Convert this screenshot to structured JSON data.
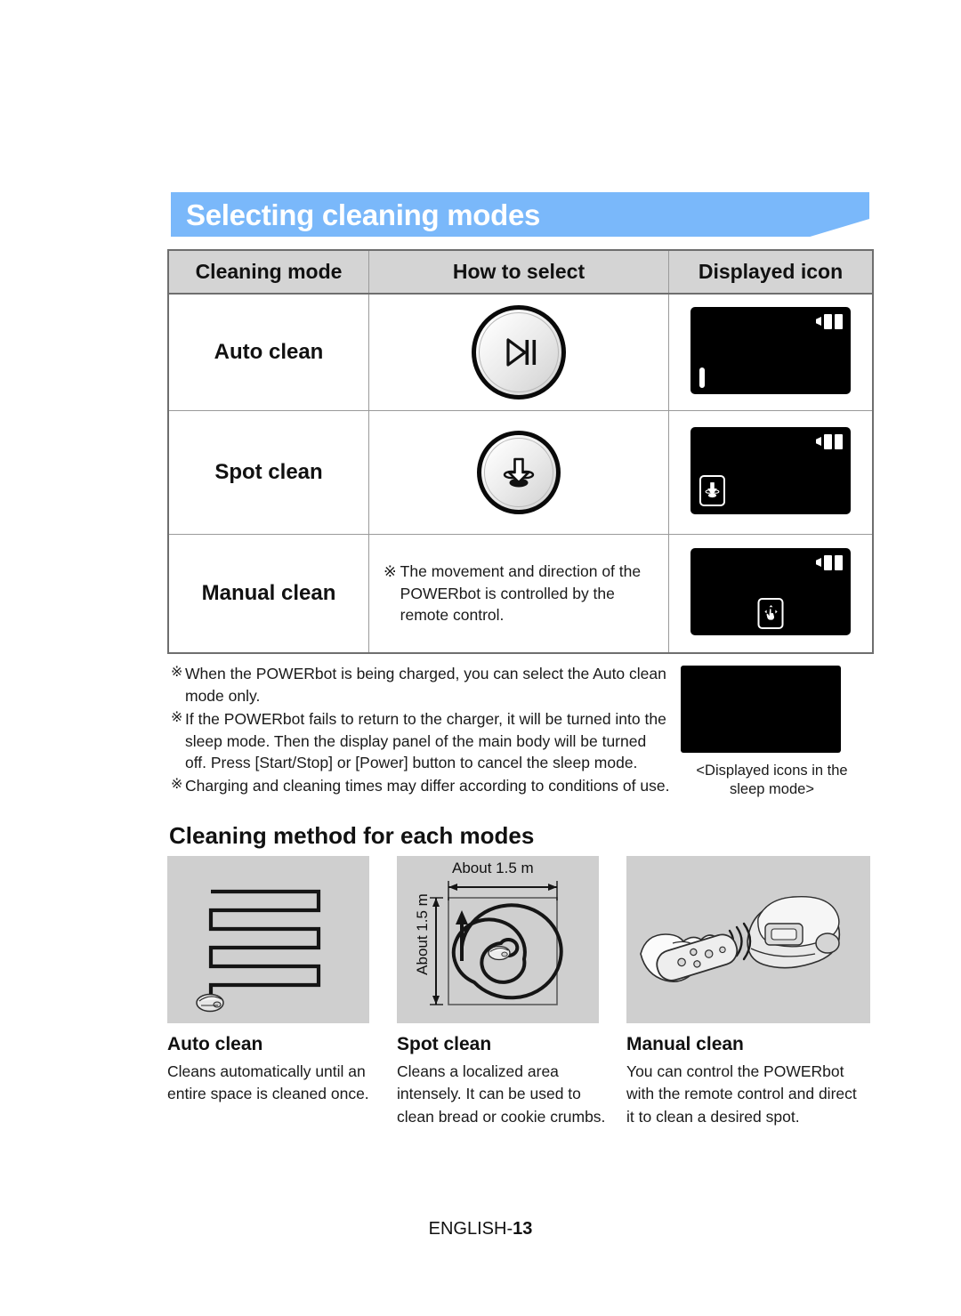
{
  "page": {
    "title": "Selecting cleaning modes",
    "footer_label": "ENGLISH-",
    "footer_number": "13"
  },
  "table": {
    "headers": [
      "Cleaning mode",
      "How to select",
      "Displayed icon"
    ],
    "rows": [
      {
        "mode": "Auto clean",
        "how_to_select_icon": "play-pause-button-icon",
        "how_to_select_text": "",
        "displayed_icon": "lcd-auto-clean-icon"
      },
      {
        "mode": "Spot clean",
        "how_to_select_icon": "spot-clean-button-icon",
        "how_to_select_text": "",
        "displayed_icon": "lcd-spot-clean-icon"
      },
      {
        "mode": "Manual clean",
        "how_to_select_icon": "",
        "how_to_select_text": "The movement and direction of the POWERbot is controlled by the remote control.",
        "displayed_icon": "lcd-manual-clean-icon"
      }
    ]
  },
  "notes": {
    "bullet_symbol": "※",
    "items": [
      "When the POWERbot is being charged, you can select the Auto clean mode only.",
      "If the POWERbot fails to return to the charger, it will be turned into the sleep mode. Then the display panel of the main body will be turned off. Press [Start/Stop] or [Power] button to cancel the sleep mode.",
      "Charging and cleaning times may differ according to conditions of use."
    ]
  },
  "sleep_figure": {
    "caption": "<Displayed icons in the sleep mode>"
  },
  "section": {
    "heading": "Cleaning method for each modes"
  },
  "methods": [
    {
      "panel": "auto-clean-zigzag-diagram",
      "title": "Auto clean",
      "description": "Cleans automatically until an entire space is cleaned once.",
      "labels": []
    },
    {
      "panel": "spot-clean-spiral-diagram",
      "title": "Spot clean",
      "description": "Cleans a localized area intensely. It can be used to clean bread or cookie crumbs.",
      "labels": [
        "About 1.5 m",
        "About 1.5 m"
      ]
    },
    {
      "panel": "manual-clean-remote-control-illustration",
      "title": "Manual clean",
      "description": "You can control the POWERbot with the remote control and direct it to clean a desired spot.",
      "labels": []
    }
  ],
  "colors": {
    "banner": "#7ab8fa",
    "table_header": "#d4d4d4",
    "panel_bg": "#cfcfcf",
    "lcd": "#000000"
  }
}
